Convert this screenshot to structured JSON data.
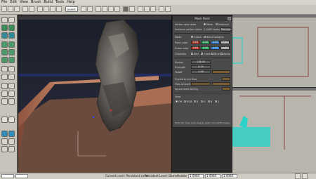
{
  "menubar": {
    "items": [
      "File",
      "Edit",
      "View",
      "Brush",
      "Build",
      "Tools",
      "Help"
    ]
  },
  "toolbar": {
    "mode_value": "Levels"
  },
  "dialog": {
    "title": "Mesh Paint",
    "vertex_color_data": "Vertex color data",
    "opt_mesh": "Mesh",
    "opt_instance": "Instance",
    "instance_vertex_colors": "Instance vertex colors",
    "instance_vertex_colors_count": "(1/400 bytes)",
    "remove_label": "Remove",
    "paint_mode": "Mode",
    "opt_colors": "Colors",
    "opt_blend": "Blend weights",
    "paint_color": "Paint color",
    "paint_color_values": [
      "0.00",
      "0.00",
      "0.00",
      "0.00"
    ],
    "erase_color": "Erase color",
    "erase_color_values": [
      "0.00",
      "0.00",
      "0.00",
      "0.00"
    ],
    "channels": "Channels",
    "channel_labels": [
      "Red",
      "Green",
      "Blue",
      "Alpha"
    ],
    "radius_label": "Radius",
    "radius_value": "128.00",
    "strength_label": "Strength",
    "strength_value": "0.25",
    "falloff_label": "Falloff",
    "falloff_value": "1.00",
    "enable_brush_flow": "Enable brush flow",
    "flow_amount": "Flow amount",
    "ignore_back_facing": "Ignore back-facing",
    "view_label": "View",
    "view_modes": [
      "Off",
      "RGB",
      "R",
      "G",
      "B",
      "A"
    ],
    "help_text": "Hold Ctrl, then Click-drag to paint. Ctrl+Shift erases."
  },
  "statusbar": {
    "current_level": "Current Level: Persistent Level",
    "persistent_level": "Persistent Level: DemoHostile",
    "grid": "1.0000",
    "snap_a": "1.0000",
    "snap_b": "1.0000"
  },
  "colors": {
    "wall": "#a2654a",
    "floor": "#6b4b3e",
    "rock": "#5a5652",
    "selection": "#2bd2c8"
  }
}
